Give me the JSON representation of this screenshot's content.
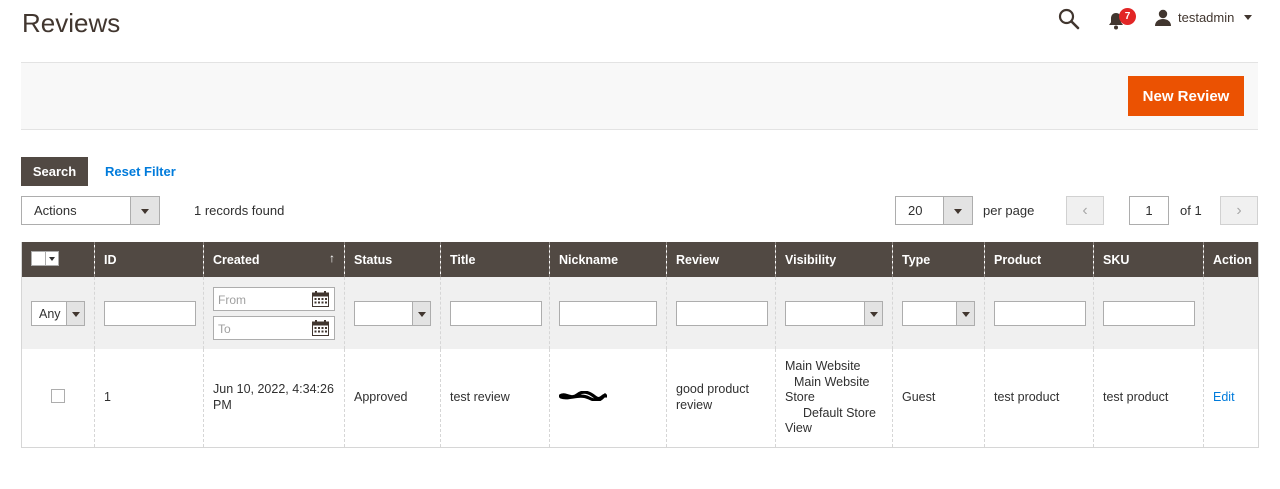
{
  "page": {
    "title": "Reviews"
  },
  "header": {
    "notification_count": "7",
    "username": "testadmin"
  },
  "action_bar": {
    "new_review_label": "New Review"
  },
  "grid_controls": {
    "search_label": "Search",
    "reset_filter_label": "Reset Filter",
    "actions_label": "Actions",
    "records_found": "1 records found",
    "per_page_value": "20",
    "per_page_label": "per page",
    "current_page": "1",
    "total_pages_label": "of 1",
    "prev_glyph": "‹",
    "next_glyph": "›"
  },
  "columns": {
    "id": "ID",
    "created": "Created",
    "status": "Status",
    "title": "Title",
    "nickname": "Nickname",
    "review": "Review",
    "visibility": "Visibility",
    "type": "Type",
    "product": "Product",
    "sku": "SKU",
    "action": "Action",
    "sort_indicator": "↑"
  },
  "filters": {
    "any_option": "Any",
    "from_placeholder": "From",
    "to_placeholder": "To"
  },
  "rows": [
    {
      "id": "1",
      "created": "Jun 10, 2022, 4:34:26 PM",
      "status": "Approved",
      "title": "test review",
      "review": "good product review",
      "visibility_website": "Main Website",
      "visibility_store": "Main Website Store",
      "visibility_view": "Default Store View",
      "type": "Guest",
      "product": "test product",
      "sku": "test product",
      "action": "Edit"
    }
  ],
  "colors": {
    "accent": "#eb5202",
    "header_bg": "#514943",
    "link": "#007bdb",
    "badge": "#e22626"
  },
  "icons": [
    "search-icon",
    "bell-icon",
    "user-icon",
    "calendar-icon",
    "chevron-left-icon",
    "chevron-right-icon"
  ]
}
